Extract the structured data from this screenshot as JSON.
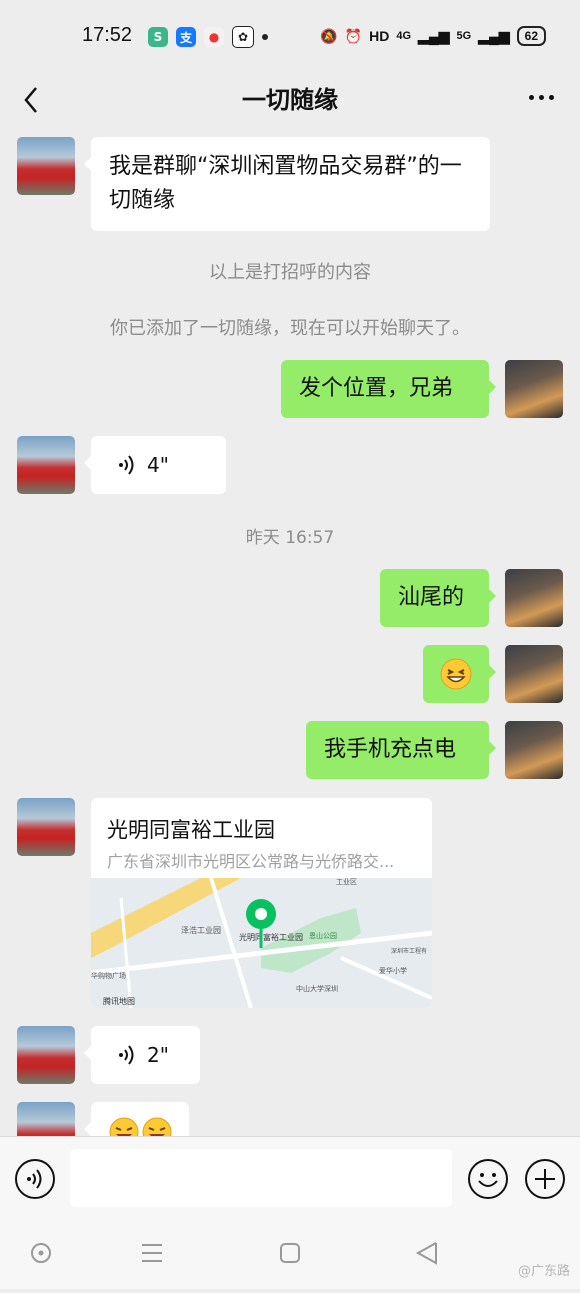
{
  "status_bar": {
    "time": "17:52",
    "right_text": "HD",
    "net1": "4G",
    "net2": "5G",
    "battery": "62",
    "app_icons": [
      "shield-app-icon",
      "alipay-icon",
      "maps-icon",
      "baidu-icon"
    ]
  },
  "header": {
    "title": "一切随缘"
  },
  "messages": {
    "m1_text": "我是群聊“深圳闲置物品交易群”的一切随缘",
    "sys1": "以上是打招呼的内容",
    "sys2": "你已添加了一切随缘，现在可以开始聊天了。",
    "m2_text": "发个位置，兄弟",
    "m3_voice": "4\"",
    "timestamp": "昨天 16:57",
    "m4_text": "汕尾的",
    "m6_text": "我手机充点电",
    "m7_location": {
      "title": "光明同富裕工业园",
      "address": "广东省深圳市光明区公常路与光侨路交...",
      "map_labels": {
        "pin_label": "光明同富裕工业园",
        "label_zeyou": "泽浩工业园",
        "label_park": "恩山公园",
        "label_school": "爱华小学",
        "label_univ": "中山大学深圳",
        "label_mall": "华购物广场",
        "label_brand": "腾讯地图",
        "label_ind": "工业区",
        "label_right": "深圳市工程有"
      }
    },
    "m8_voice": "2\""
  },
  "colors": {
    "outgoing_bubble": "#95ec69",
    "incoming_bubble": "#ffffff",
    "background": "#ededed",
    "map_pin": "#07c160"
  },
  "watermark": "@广东路"
}
